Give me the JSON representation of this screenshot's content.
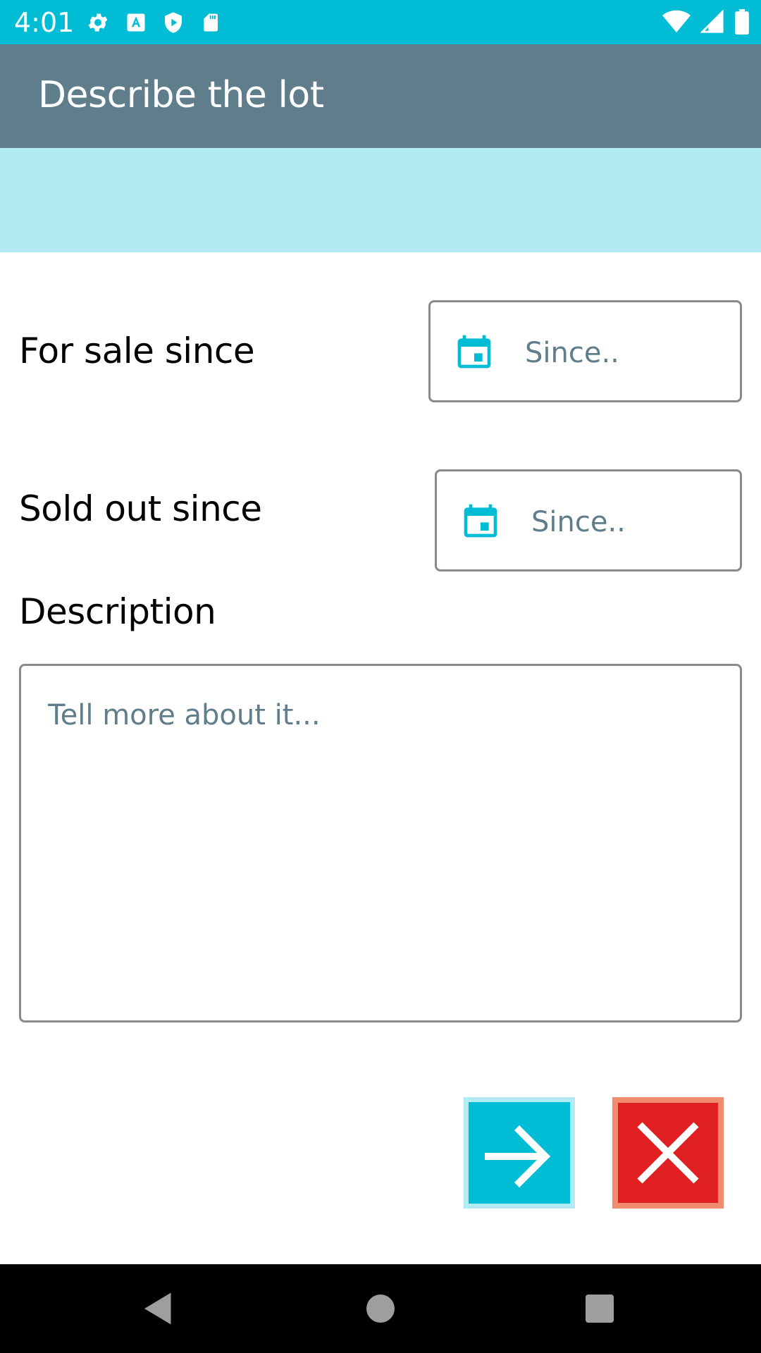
{
  "status_bar": {
    "time": "4:01",
    "left_icons": [
      "settings-icon",
      "font-a-icon",
      "shield-play-icon",
      "sd-card-icon"
    ],
    "right_icons": [
      "wifi-icon",
      "signal-icon",
      "battery-icon"
    ],
    "color": "#00bcd4"
  },
  "app_bar": {
    "title": "Describe the lot",
    "color": "#607d8b"
  },
  "banner": {
    "color": "#b2ebf2"
  },
  "form": {
    "for_sale": {
      "label": "For sale since",
      "placeholder": "Since..",
      "icon": "calendar-icon"
    },
    "sold_out": {
      "label": "Sold out since",
      "placeholder": "Since..",
      "icon": "calendar-icon"
    },
    "description": {
      "label": "Description",
      "placeholder": "Tell more about it..."
    }
  },
  "actions": {
    "next": {
      "icon": "arrow-right-icon",
      "color": "#00bcd4"
    },
    "cancel": {
      "icon": "close-icon",
      "color": "#e02020"
    }
  },
  "nav_bar": {
    "buttons": [
      "back-icon",
      "home-icon",
      "recents-icon"
    ]
  }
}
